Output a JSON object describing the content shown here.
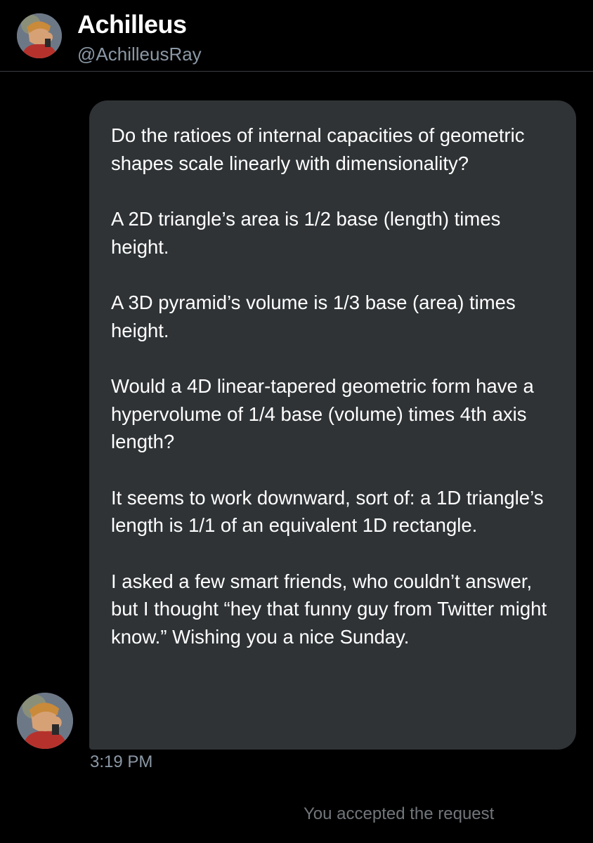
{
  "header": {
    "display_name": "Achilleus",
    "username": "@AchilleusRay"
  },
  "message": {
    "paragraphs": [
      "Do the ratioes of internal capacities of geometric shapes scale linearly with dimensionality?",
      "A 2D triangle’s area is 1/2 base (length) times height.",
      "A 3D pyramid’s volume is 1/3 base (area) times height.",
      "Would a 4D linear-tapered geometric form have a hypervolume of 1/4 base (volume) times 4th axis length?",
      "It seems to work downward, sort of: a 1D triangle’s length is 1/1 of an equivalent 1D rectangle.",
      "I asked a few smart friends, who couldn’t answer, but I thought “hey that funny guy from Twitter might know.” Wishing you a nice Sunday."
    ],
    "timestamp": "3:19 PM"
  },
  "system_note": "You accepted the request",
  "icons": {
    "header_avatar": "avatar-illustration",
    "message_avatar": "avatar-illustration"
  },
  "colors": {
    "background": "#000000",
    "bubble": "#2f3336",
    "secondary_text": "#8b98a5",
    "divider": "#3a3d42"
  }
}
